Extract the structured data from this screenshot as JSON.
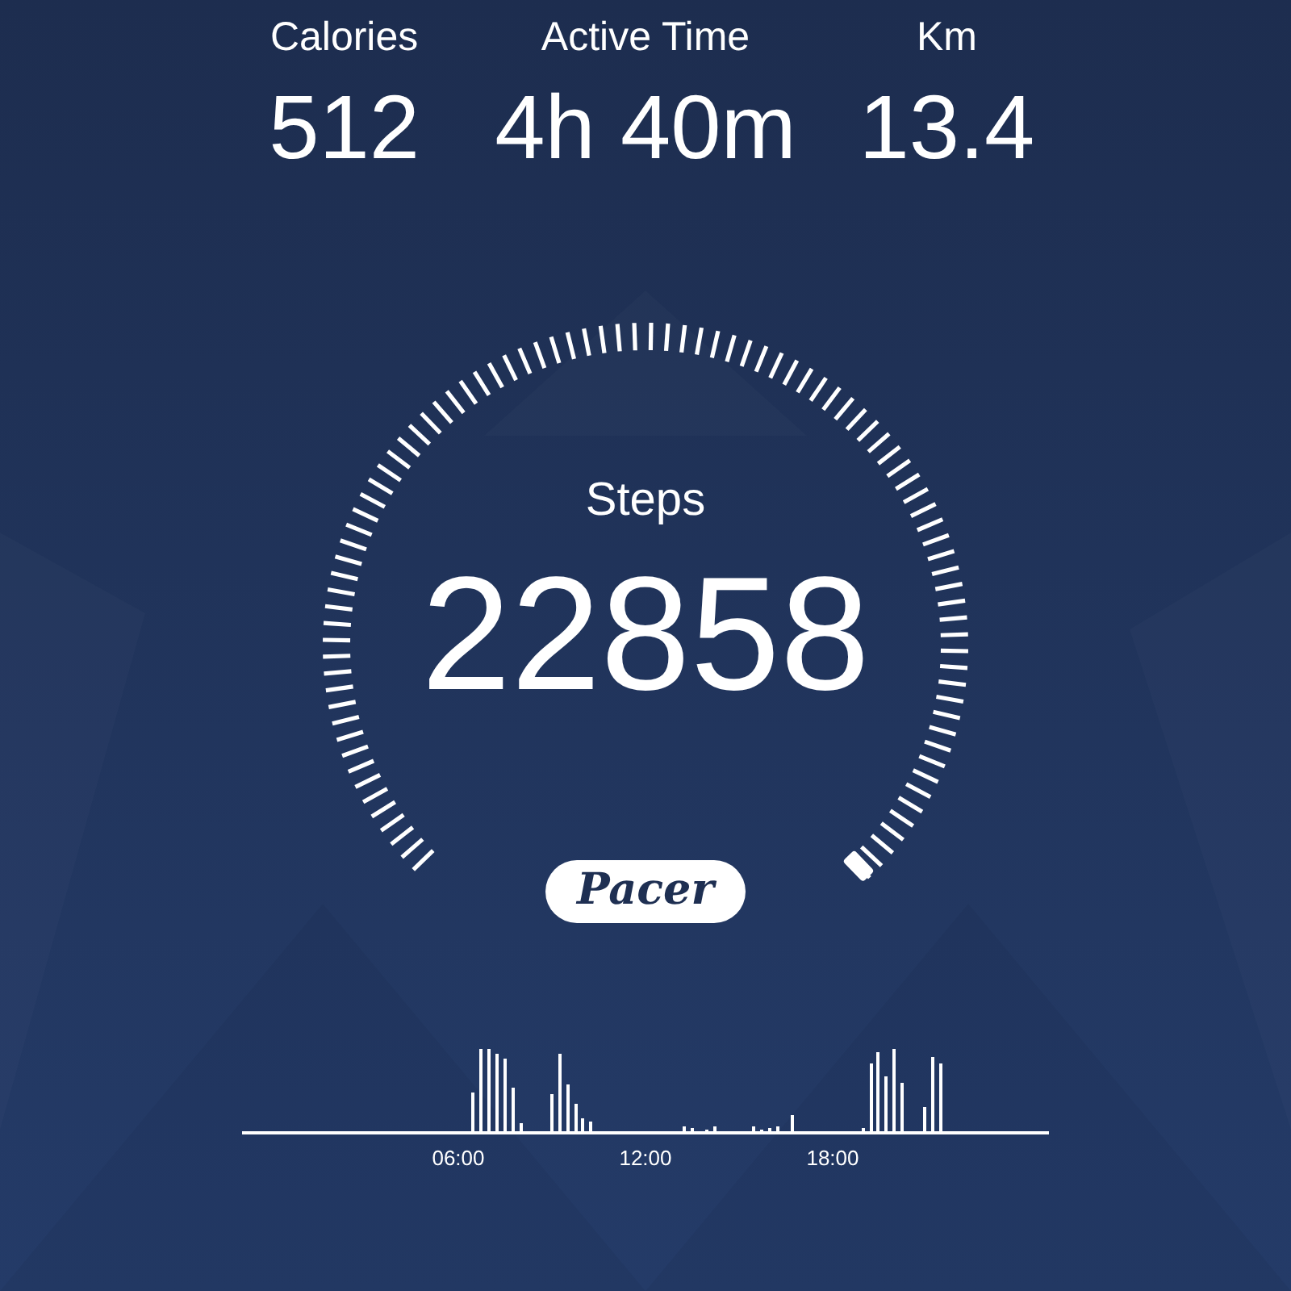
{
  "stats": [
    {
      "label": "Calories",
      "value": "512"
    },
    {
      "label": "Active Time",
      "value": "4h 40m"
    },
    {
      "label": "Km",
      "value": "13.4"
    }
  ],
  "gauge": {
    "label": "Steps",
    "value": "22858"
  },
  "logo": "Pacer",
  "activity_chart": {
    "time_labels": [
      "06:00",
      "12:00",
      "18:00"
    ]
  }
}
